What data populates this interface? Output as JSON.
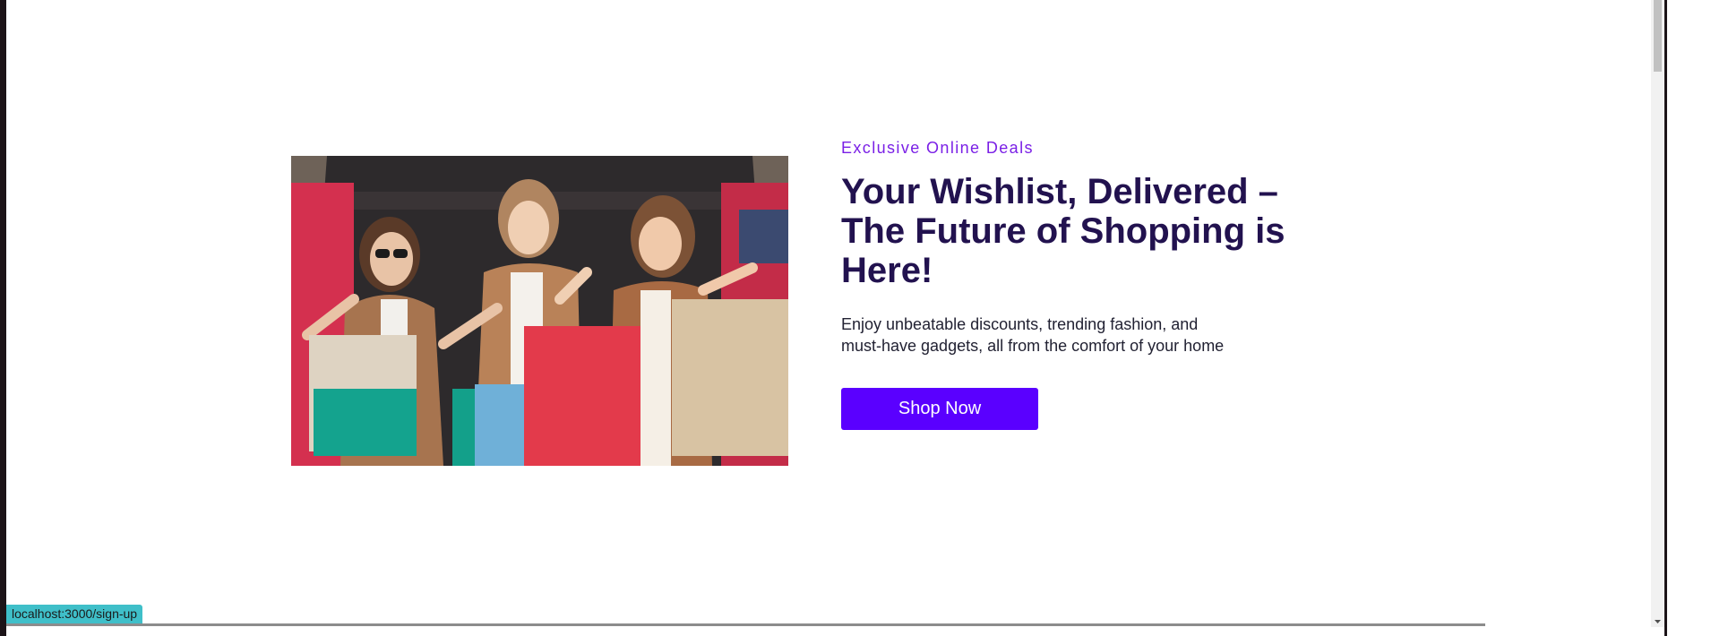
{
  "hero": {
    "eyebrow": "Exclusive Online Deals",
    "headline": "Your Wishlist, Delivered – The Future of Shopping is Here!",
    "subtext": "Enjoy unbeatable discounts, trending fashion, and must-have gadgets, all from the comfort of your home",
    "cta_label": "Shop Now",
    "image_icon": "shopping-women-photo"
  },
  "status_bar": {
    "url": "localhost:3000/sign-up"
  },
  "colors": {
    "accent": "#5a00ff",
    "eyebrow": "#7a1fe6",
    "headline": "#22124f",
    "status_bar": "#3fbfc9"
  }
}
